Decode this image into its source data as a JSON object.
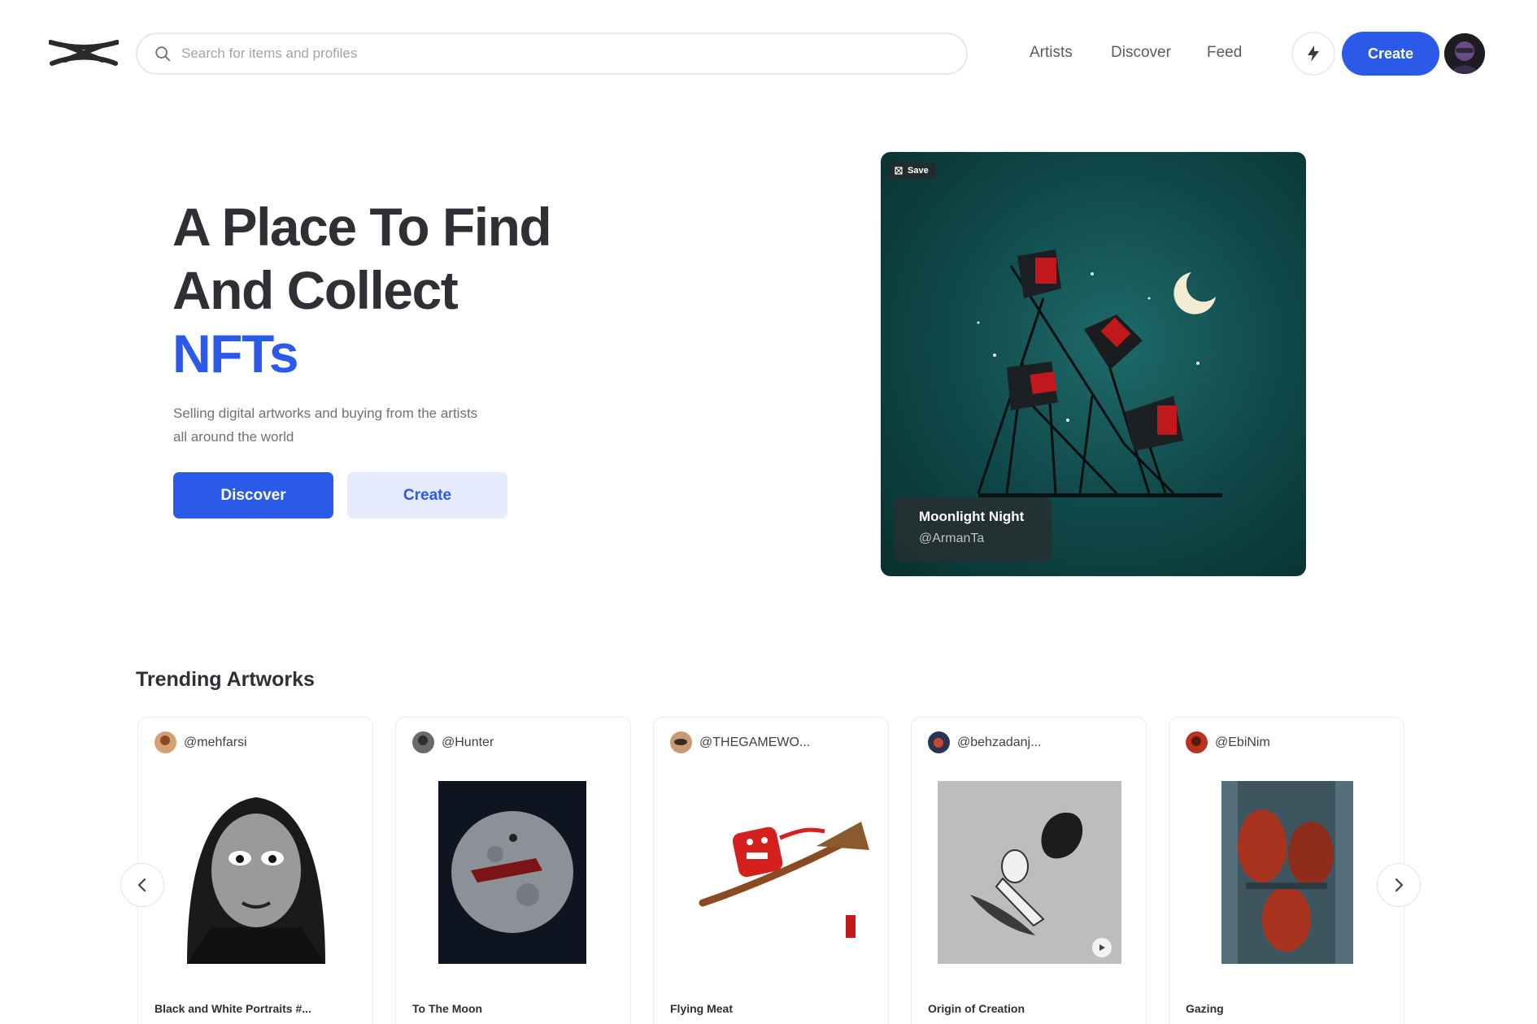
{
  "header": {
    "search_placeholder": "Search for items and profiles",
    "nav": [
      "Artists",
      "Discover",
      "Feed"
    ],
    "create_label": "Create"
  },
  "hero": {
    "title_line1": "A Place To Find",
    "title_line2": "And Collect",
    "title_accent": "NFTs",
    "subtitle": "Selling digital artworks and buying from the artists all around the world",
    "discover_label": "Discover",
    "create_label": "Create"
  },
  "feature": {
    "save_label": "Save",
    "title": "Moonlight Night",
    "artist": "@ArmanTa"
  },
  "trending": {
    "title": "Trending Artworks",
    "cards": [
      {
        "user": "@mehfarsi",
        "title": "Black and White Portraits #..."
      },
      {
        "user": "@Hunter",
        "title": "To The Moon"
      },
      {
        "user": "@THEGAMEWO...",
        "title": "Flying Meat"
      },
      {
        "user": "@behzadanj...",
        "title": "Origin of Creation"
      },
      {
        "user": "@EbiNim",
        "title": "Gazing"
      }
    ]
  },
  "colors": {
    "accent": "#2b5ae8",
    "accent_light": "#e5eafc",
    "text": "#2f2f35"
  }
}
